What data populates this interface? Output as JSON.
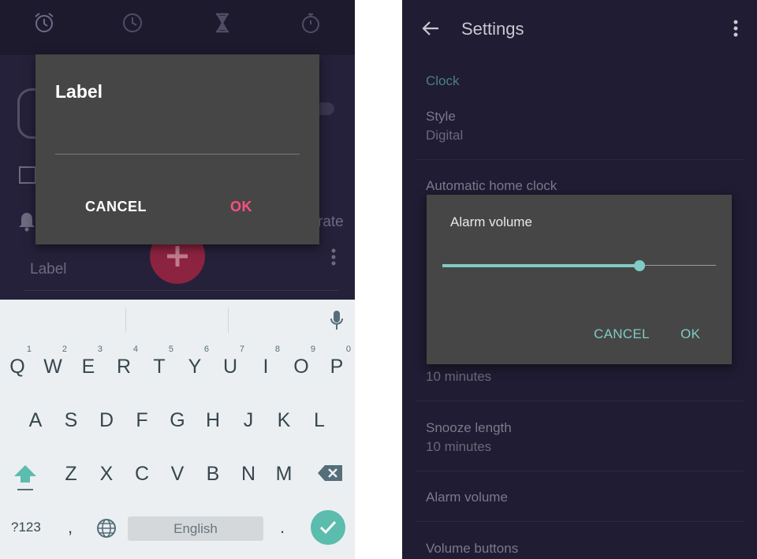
{
  "left": {
    "tabs": [
      "alarm-icon",
      "clock-icon",
      "timer-icon",
      "stopwatch-icon"
    ],
    "background": {
      "label_text": "Label",
      "vibrate_text": "rate"
    },
    "fab_icon": "plus-icon",
    "label_dialog": {
      "title": "Label",
      "cancel": "CANCEL",
      "ok": "OK"
    },
    "keyboard": {
      "row1": [
        {
          "key": "Q",
          "hint": "1"
        },
        {
          "key": "W",
          "hint": "2"
        },
        {
          "key": "E",
          "hint": "3"
        },
        {
          "key": "R",
          "hint": "4"
        },
        {
          "key": "T",
          "hint": "5"
        },
        {
          "key": "Y",
          "hint": "6"
        },
        {
          "key": "U",
          "hint": "7"
        },
        {
          "key": "I",
          "hint": "8"
        },
        {
          "key": "O",
          "hint": "9"
        },
        {
          "key": "P",
          "hint": "0"
        }
      ],
      "row2": [
        "A",
        "S",
        "D",
        "F",
        "G",
        "H",
        "J",
        "K",
        "L"
      ],
      "row3": [
        "Z",
        "X",
        "C",
        "V",
        "B",
        "N",
        "M"
      ],
      "symbols": "?123",
      "comma": ",",
      "space": "English",
      "period": "."
    }
  },
  "right": {
    "header": {
      "title": "Settings"
    },
    "section": "Clock",
    "prefs": [
      {
        "title": "Style",
        "summary": "Digital"
      },
      {
        "title": "Automatic home clock",
        "summary": ""
      },
      {
        "title": "",
        "summary": "10 minutes"
      },
      {
        "title": "Snooze length",
        "summary": "10 minutes"
      },
      {
        "title": "Alarm volume",
        "summary": ""
      },
      {
        "title": "Volume buttons",
        "summary": ""
      }
    ],
    "volume_dialog": {
      "title": "Alarm volume",
      "level": 0.72,
      "cancel": "CANCEL",
      "ok": "OK"
    }
  },
  "colors": {
    "accent_pink": "#ff4f81",
    "accent_teal": "#80cbc4",
    "fab_red": "#8c2340"
  }
}
